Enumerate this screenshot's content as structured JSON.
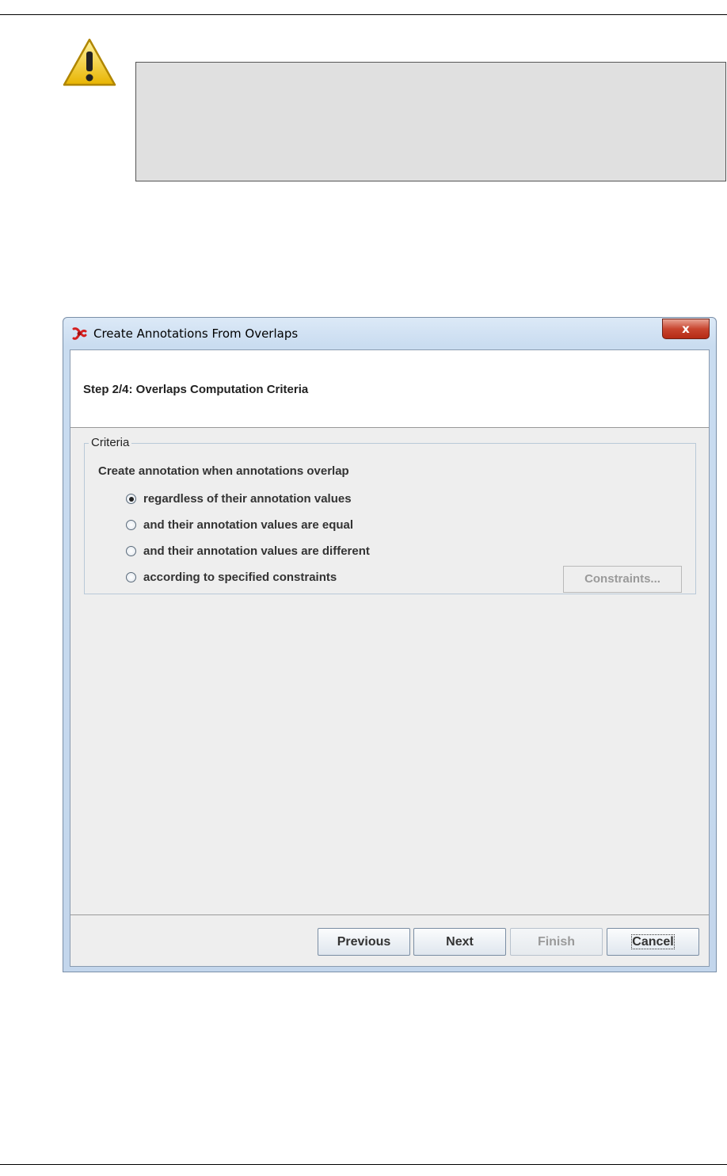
{
  "warning": {
    "icon": "warning-icon",
    "text": ""
  },
  "dialog": {
    "title": "Create Annotations From Overlaps",
    "app_icon": "gate-app-icon",
    "close_label": "x",
    "step_title": "Step 2/4: Overlaps Computation Criteria",
    "criteria": {
      "legend": "Criteria",
      "description": "Create annotation when annotations overlap",
      "options": [
        {
          "label": "regardless of their annotation values",
          "checked": true
        },
        {
          "label": "and their annotation values are equal",
          "checked": false
        },
        {
          "label": "and their annotation values are different",
          "checked": false
        },
        {
          "label": "according to specified constraints",
          "checked": false
        }
      ],
      "constraints_button": "Constraints..."
    },
    "buttons": {
      "previous": "Previous",
      "next": "Next",
      "finish": "Finish",
      "cancel": "Cancel"
    }
  }
}
